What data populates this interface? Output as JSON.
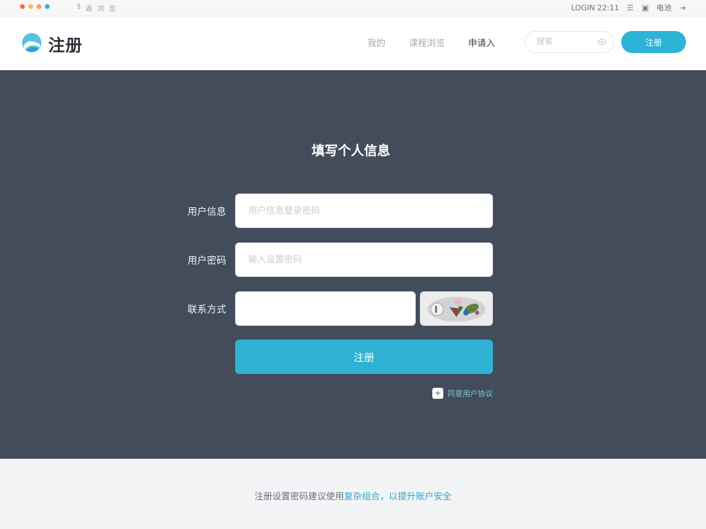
{
  "chrome": {
    "tabs": [
      "§",
      "返",
      "浏",
      "览"
    ],
    "status_text": "LOGIN 22:11",
    "battery_text": "电池"
  },
  "header": {
    "brand": "注册",
    "nav": [
      "我的",
      "课程浏览",
      "申请入"
    ],
    "search_placeholder": "搜索",
    "register_button": "注册"
  },
  "form": {
    "title": "填写个人信息",
    "fields": [
      {
        "label": "用户信息",
        "placeholder": "用户信息登录密码"
      },
      {
        "label": "用户密码",
        "placeholder": "输入设置密码"
      },
      {
        "label": "联系方式",
        "placeholder": ""
      }
    ],
    "submit_label": "注册",
    "agree_text": "同意用户协议"
  },
  "footer": {
    "text_muted": "注册设置密码建议使用",
    "text_highlight": "复杂组合，以提升账户安全"
  },
  "colors": {
    "accent": "#2fb2d3",
    "main_bg": "#434c5b",
    "footer_bg": "#f3f4f6"
  },
  "icons": {
    "logo": "wave-logo-icon",
    "search_eye": "eye-icon",
    "menu": "menu-icon",
    "tab": "tab-icon",
    "arrow": "exit-arrow-icon",
    "agree_checkbox": "checkbox-icon"
  }
}
